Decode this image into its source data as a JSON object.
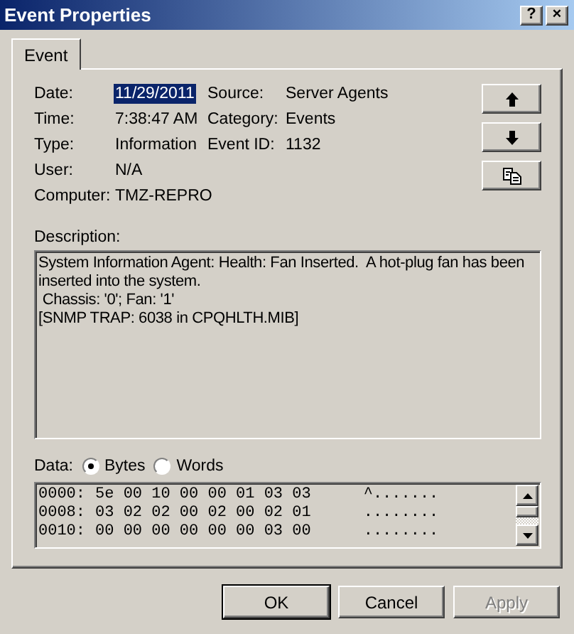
{
  "window": {
    "title": "Event Properties",
    "help": "?",
    "close": "×"
  },
  "tabs": [
    {
      "label": "Event",
      "selected": true
    }
  ],
  "fields_left": [
    {
      "label": "Date:",
      "value": "11/29/2011",
      "selected": true
    },
    {
      "label": "Time:",
      "value": "7:38:47 AM",
      "selected": false
    },
    {
      "label": "Type:",
      "value": "Information",
      "selected": false
    },
    {
      "label": "User:",
      "value": "N/A",
      "selected": false
    },
    {
      "label": "Computer:",
      "value": "TMZ-REPRO",
      "selected": false
    }
  ],
  "fields_right": [
    {
      "label": "Source:",
      "value": "Server Agents"
    },
    {
      "label": "Category:",
      "value": "Events"
    },
    {
      "label": "Event ID:",
      "value": "1132"
    }
  ],
  "description": {
    "label": "Description:",
    "lines": [
      "System Information Agent: Health: Fan Inserted.  A hot-plug fan has been",
      "inserted into the system.",
      " Chassis: '0'; Fan: '1'",
      "[SNMP TRAP: 6038 in CPQHLTH.MIB]"
    ]
  },
  "data": {
    "label": "Data:",
    "options": [
      {
        "label": "Bytes",
        "selected": true
      },
      {
        "label": "Words",
        "selected": false
      }
    ],
    "rows": [
      {
        "offset": "0000:",
        "bytes": "5e 00 10 00 00 01 03 03",
        "ascii": "^......."
      },
      {
        "offset": "0008:",
        "bytes": "03 02 02 00 02 00 02 01",
        "ascii": "........"
      },
      {
        "offset": "0010:",
        "bytes": "00 00 00 00 00 00 03 00",
        "ascii": "........"
      }
    ]
  },
  "buttons": [
    {
      "label": "OK",
      "default": true,
      "disabled": false
    },
    {
      "label": "Cancel",
      "default": false,
      "disabled": false
    },
    {
      "label": "Apply",
      "default": false,
      "disabled": true
    }
  ]
}
